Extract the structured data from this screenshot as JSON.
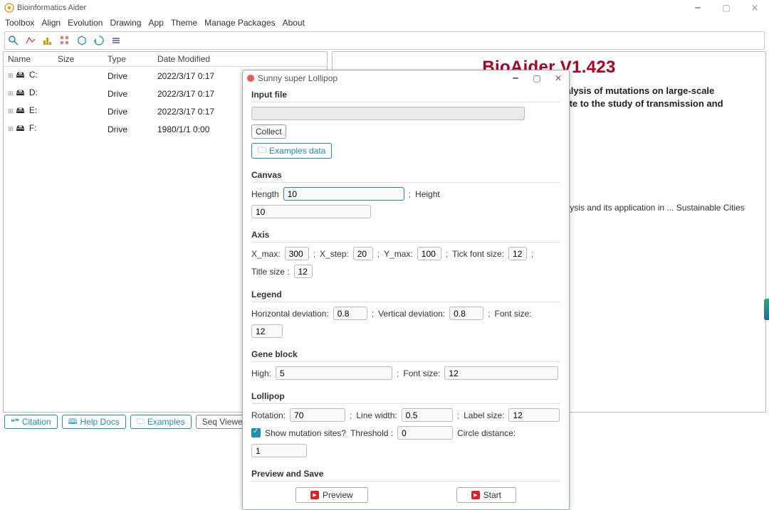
{
  "app": {
    "title": "Bioinformatics Aider"
  },
  "menus": [
    "Toolbox",
    "Align",
    "Evolution",
    "Drawing",
    "App",
    "Theme",
    "Manage Packages",
    "About"
  ],
  "filetable": {
    "headers": [
      "Name",
      "Size",
      "Type",
      "Date Modified"
    ],
    "rows": [
      {
        "name": "C:",
        "size": "",
        "type": "Drive",
        "date": "2022/3/17 0:17",
        "ico": "🖴"
      },
      {
        "name": "D:",
        "size": "",
        "type": "Drive",
        "date": "2022/3/17 0:17",
        "ico": "🖴"
      },
      {
        "name": "E:",
        "size": "",
        "type": "Drive",
        "date": "2022/3/17 0:17",
        "ico": "🖴"
      },
      {
        "name": "F:",
        "size": "",
        "type": "Drive",
        "date": "1980/1/1 0:00",
        "ico": "🖴"
      }
    ]
  },
  "content": {
    "heading": "BioAider V1.423",
    "para1": "BioAider was designed for automatic functional analysis of mutations on large-scale sequences of viral transmission and could contribute to the study of transmission and genomic pathogens.",
    "cite": "Zhou Z et al. BioAider: An efficient tool for viral genome analysis and its application in ... Sustainable Cities Soc. 2020;63:102466. doi:10.1016/j.scs."
  },
  "bottom": {
    "citation": "Citation",
    "help": "Help Docs",
    "examples": "Examples",
    "seq": "Seq Viewer"
  },
  "dialog": {
    "title": "Sunny super Lollipop",
    "input_section": "Input file",
    "input_value": "",
    "collect": "Collect",
    "examples": "Examples data",
    "canvas": {
      "title": "Canvas",
      "hength_lbl": "Hength",
      "hength_val": "10",
      "height_lbl": "Height",
      "height_val": "10"
    },
    "axis": {
      "title": "Axis",
      "xmax_lbl": "X_max:",
      "xmax_val": "300",
      "xstep_lbl": "X_step:",
      "xstep_val": "20",
      "ymax_lbl": "Y_max:",
      "ymax_val": "100",
      "tick_lbl": "Tick font size:",
      "tick_val": "12",
      "title_lbl": "Title size :",
      "title_val": "12"
    },
    "legend": {
      "title": "Legend",
      "hdev_lbl": "Horizontal deviation:",
      "hdev_val": "0.8",
      "vdev_lbl": "Vertical deviation:",
      "vdev_val": "0.8",
      "font_lbl": "Font size:",
      "font_val": "12"
    },
    "gene": {
      "title": "Gene block",
      "high_lbl": "High:",
      "high_val": "5",
      "font_lbl": "Font size:",
      "font_val": "12"
    },
    "lolli": {
      "title": "Lollipop",
      "rot_lbl": "Rotation:",
      "rot_val": "70",
      "line_lbl": "Line width:",
      "line_val": "0.5",
      "label_lbl": "Label size:",
      "label_val": "12",
      "show_lbl": "Show mutation sites?",
      "thr_lbl": "Threshold :",
      "thr_val": "0",
      "circ_lbl": "Circle distance:",
      "circ_val": "1"
    },
    "preview_section": "Preview and Save",
    "preview_btn": "Preview",
    "start_btn": "Start"
  }
}
